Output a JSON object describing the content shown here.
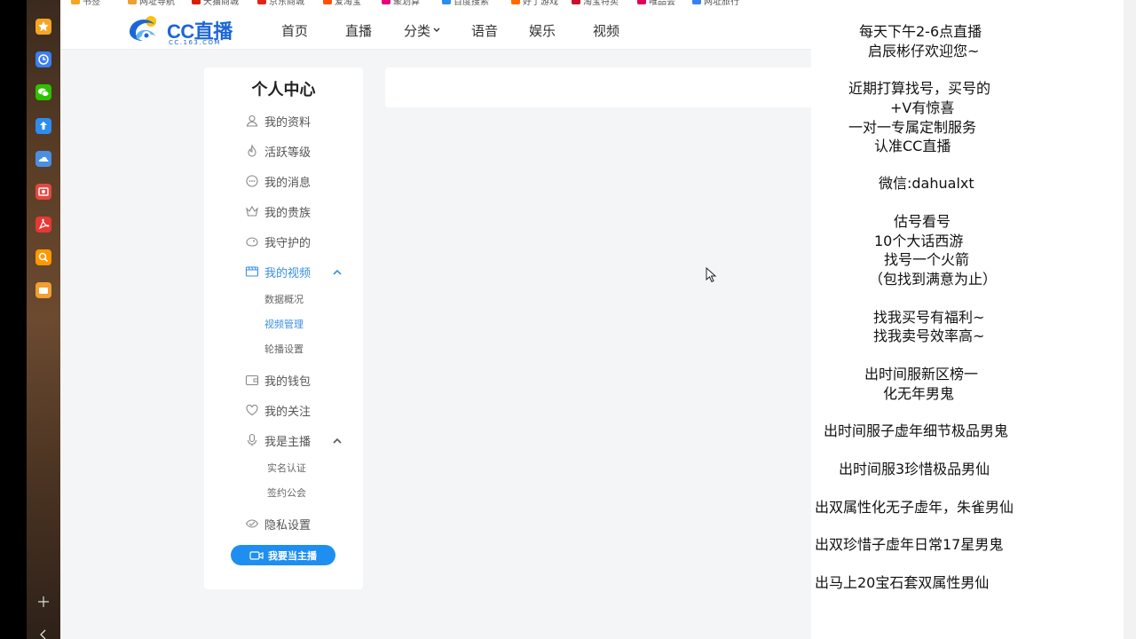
{
  "bookmarks": [
    "书签",
    "网址导航",
    "天猫商城",
    "京东商城",
    "爱淘宝",
    "聚划算",
    "百度搜索",
    "好了游戏",
    "淘宝特卖",
    "唯品会",
    "网址旅行"
  ],
  "header": {
    "logo_text": "CC直播",
    "logo_sub": "CC.163.COM",
    "nav": [
      "首页",
      "直播",
      "分类",
      "语音",
      "娱乐",
      "视频"
    ]
  },
  "sidebar": {
    "title": "个人中心",
    "items": [
      {
        "label": "我的资料",
        "icon": "user-icon"
      },
      {
        "label": "活跃等级",
        "icon": "flame-icon"
      },
      {
        "label": "我的消息",
        "icon": "message-icon"
      },
      {
        "label": "我的贵族",
        "icon": "crown-icon"
      },
      {
        "label": "我守护的",
        "icon": "guard-icon"
      },
      {
        "label": "我的视频",
        "icon": "video-icon",
        "active": true
      },
      {
        "label": "我的钱包",
        "icon": "wallet-icon"
      },
      {
        "label": "我的关注",
        "icon": "heart-icon"
      },
      {
        "label": "我是主播",
        "icon": "mic-icon"
      },
      {
        "label": "隐私设置",
        "icon": "privacy-icon"
      }
    ],
    "video_sub": [
      "数据概况",
      "视频管理",
      "轮播设置"
    ],
    "anchor_sub": [
      "实名认证",
      "签约公会"
    ],
    "cta_label": "我要当主播"
  },
  "overlay": {
    "lines": [
      "每天下午2-6点直播",
      "启辰彬仔欢迎您~",
      "近期打算找号，买号的",
      "+V有惊喜",
      "一对一专属定制服务",
      "认准CC直播",
      "微信:dahualxt",
      "估号看号",
      "10个大话西游",
      "找号一个火箭",
      "（包找到满意为止）",
      "找我买号有福利~",
      "找我卖号效率高~",
      "出时间服新区榜一",
      "化无年男鬼",
      "出时间服子虚年细节极品男鬼",
      "出时间服3珍惜极品男仙",
      "出双属性化无子虚年，朱雀男仙",
      "出双珍惜子虚年日常17星男鬼",
      "出马上20宝石套双属性男仙"
    ]
  },
  "colors": {
    "accent": "#3a8ee6",
    "cta": "#1e8ff0",
    "logo": "#1c66d8"
  }
}
